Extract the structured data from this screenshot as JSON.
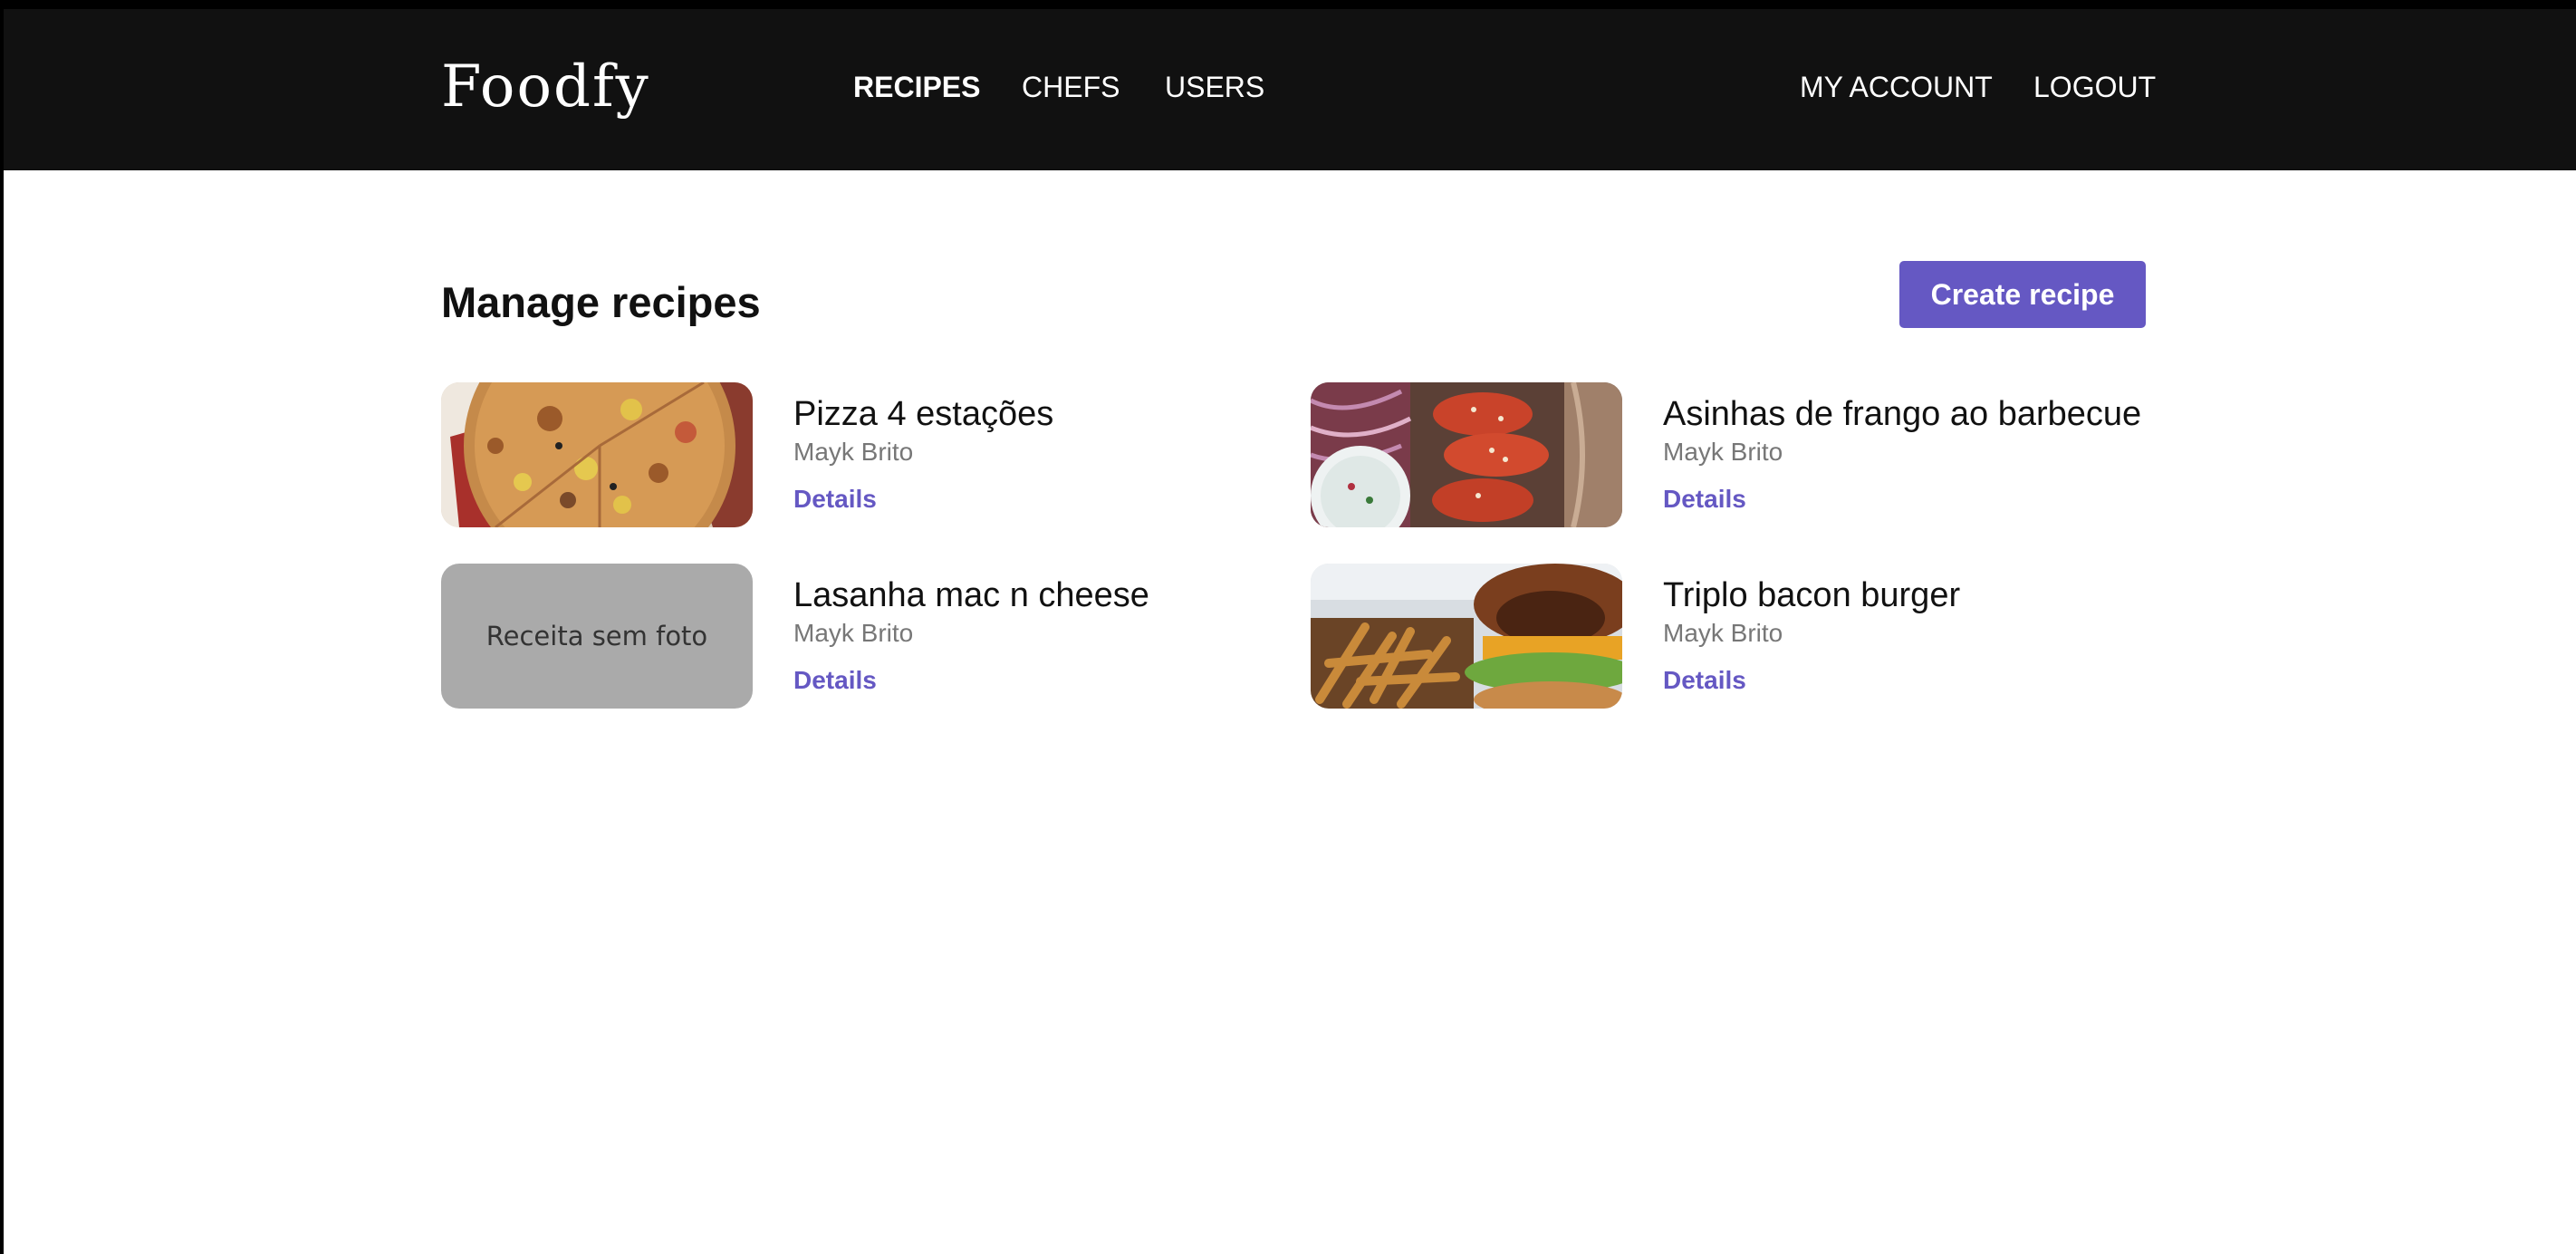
{
  "header": {
    "logo": "Foodfy",
    "nav": {
      "recipes": "RECIPES",
      "chefs": "CHEFS",
      "users": "USERS",
      "account": "MY ACCOUNT",
      "logout": "LOGOUT"
    },
    "active_nav": "recipes"
  },
  "main": {
    "title": "Manage recipes",
    "create_label": "Create recipe",
    "recipes": [
      {
        "title": "Pizza 4 estações",
        "author": "Mayk Brito",
        "details": "Details",
        "image": "pizza-photo"
      },
      {
        "title": "Asinhas de frango ao barbecue",
        "author": "Mayk Brito",
        "details": "Details",
        "image": "chicken-wings-photo"
      },
      {
        "title": "Lasanha mac n cheese",
        "author": "Mayk Brito",
        "details": "Details",
        "image": "no-photo",
        "no_photo_text": "Receita sem foto"
      },
      {
        "title": "Triplo bacon burger",
        "author": "Mayk Brito",
        "details": "Details",
        "image": "burger-photo"
      }
    ]
  },
  "colors": {
    "header_bg": "#111111",
    "accent": "#6558c3",
    "author_text": "#777777",
    "placeholder_bg": "#aaaaaa"
  }
}
